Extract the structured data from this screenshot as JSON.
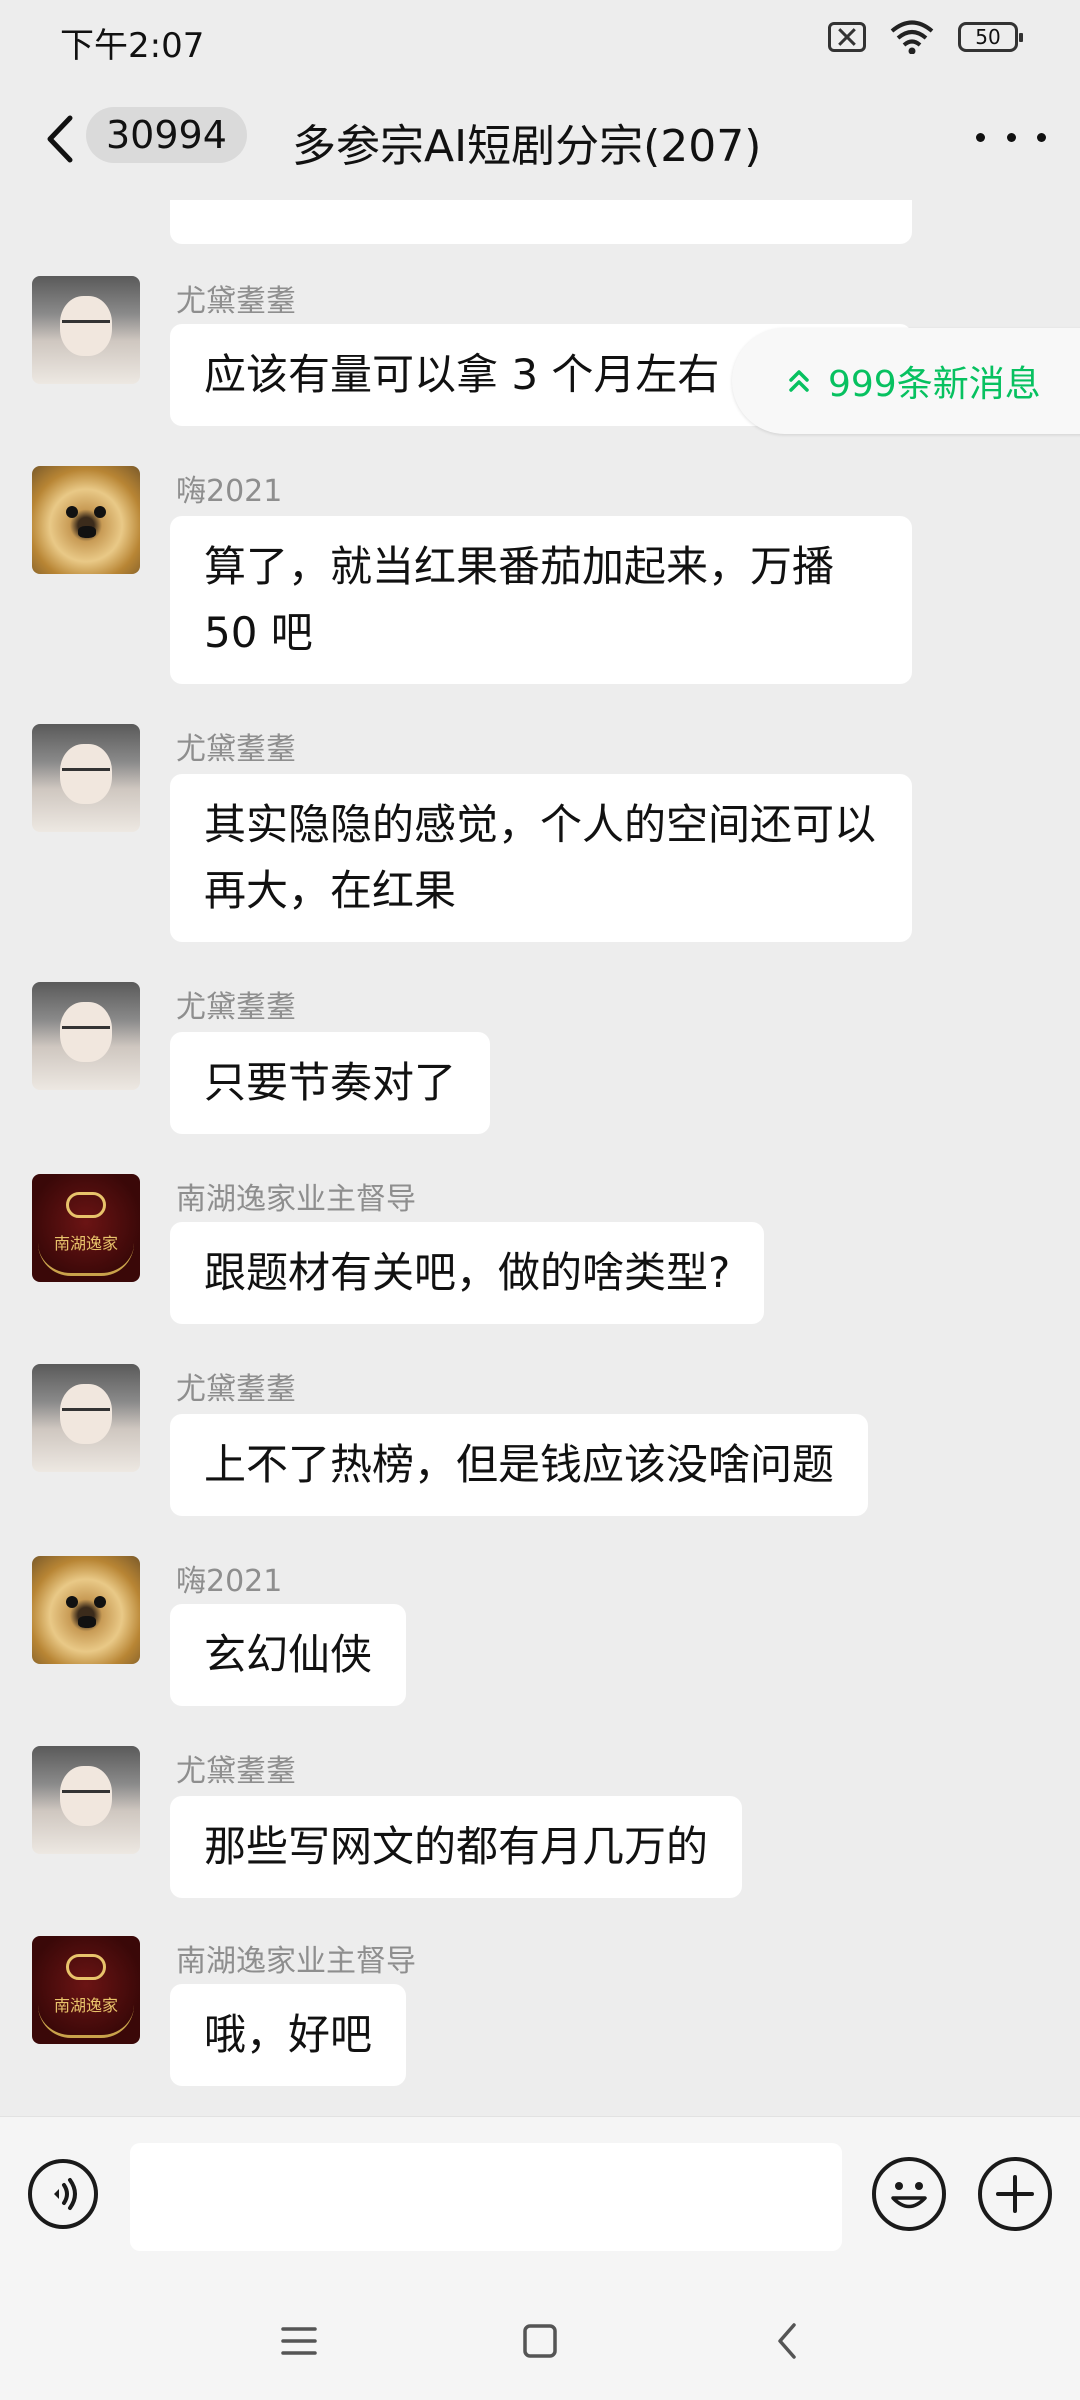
{
  "status": {
    "time": "下午2:07",
    "battery": "50"
  },
  "header": {
    "back_count": "30994",
    "title": "多参宗AI短剧分宗(207)"
  },
  "banner": {
    "new_messages": "999条新消息"
  },
  "messages": [
    {
      "sender": "尤黛耋耋",
      "text": "应该有量可以拿 3 个月左右"
    },
    {
      "sender": "嗨2021",
      "text": "算了，就当红果番茄加起来，万播50 吧"
    },
    {
      "sender": "尤黛耋耋",
      "text": "其实隐隐的感觉，个人的空间还可以再大，在红果"
    },
    {
      "sender": "尤黛耋耋",
      "text": "只要节奏对了"
    },
    {
      "sender": "南湖逸家业主督导",
      "text": "跟题材有关吧，做的啥类型?"
    },
    {
      "sender": "尤黛耋耋",
      "text": "上不了热榜，但是钱应该没啥问题"
    },
    {
      "sender": "嗨2021",
      "text": "玄幻仙侠"
    },
    {
      "sender": "尤黛耋耋",
      "text": "那些写网文的都有月几万的"
    },
    {
      "sender": "南湖逸家业主督导",
      "text": "哦，好吧"
    }
  ],
  "logo_text": "南湖逸家",
  "input": {
    "value": "",
    "placeholder": ""
  },
  "colors": {
    "accent": "#07C160",
    "bubble": "#FFFFFF",
    "background": "#EDEDED"
  }
}
